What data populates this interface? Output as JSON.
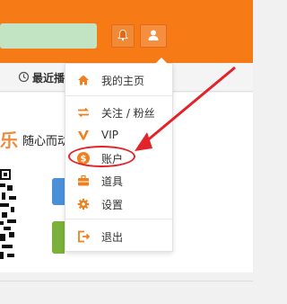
{
  "header": {
    "search_value": "",
    "bell_icon": "bell-icon",
    "user_icon": "user-icon",
    "accent_color": "#f67b17"
  },
  "nav": {
    "recent_label": "最近播"
  },
  "banner": {
    "brand_char": "乐",
    "text": "随心而动"
  },
  "menu": {
    "items": [
      {
        "label": "我的主页",
        "icon": "home-icon"
      },
      {
        "label": "关注 / 粉丝",
        "icon": "arrows-swap-icon"
      },
      {
        "label": "VIP",
        "icon": "vip-icon"
      },
      {
        "label": "账户",
        "icon": "coin-icon"
      },
      {
        "label": "道具",
        "icon": "toolbox-icon"
      },
      {
        "label": "设置",
        "icon": "gear-icon"
      },
      {
        "label": "退出",
        "icon": "logout-icon"
      }
    ]
  },
  "annotation": {
    "color": "#e2232a",
    "target": "账户"
  }
}
